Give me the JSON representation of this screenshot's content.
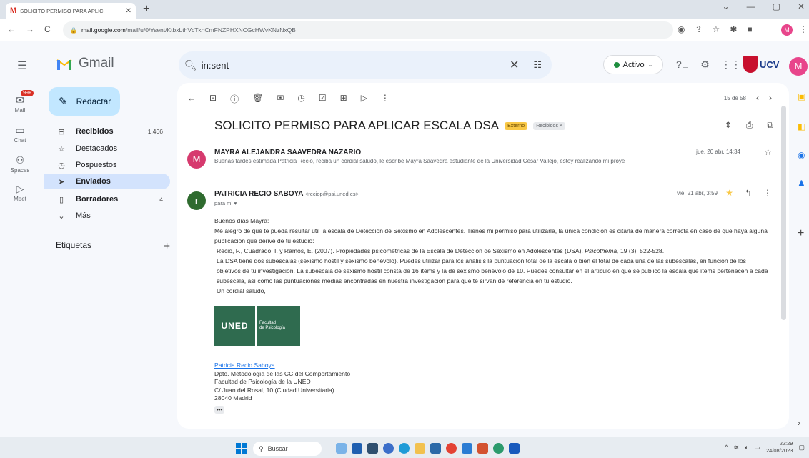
{
  "browser": {
    "tab_title": "SOLICITO PERMISO PARA APLIC.",
    "url_prefix": "mail.google.com",
    "url_rest": "/mail/u/0/#sent/KtbxLthVcTkhCmFNZPHXNCGcHWvKNzNxQB",
    "profile_initial": "M"
  },
  "gmail": {
    "logo_text": "Gmail",
    "search_value": "in:sent",
    "status_label": "Activo",
    "brand_logo_text": "UCV",
    "avatar_initial": "M"
  },
  "rail": [
    {
      "label": "Mail",
      "icon": "mail-icon",
      "badge": "99+"
    },
    {
      "label": "Chat",
      "icon": "chat-icon"
    },
    {
      "label": "Spaces",
      "icon": "spaces-icon"
    },
    {
      "label": "Meet",
      "icon": "meet-icon"
    }
  ],
  "compose_label": "Redactar",
  "nav": [
    {
      "label": "Recibidos",
      "count": "1.406",
      "icon": "inbox-icon",
      "bold": true
    },
    {
      "label": "Destacados",
      "count": "",
      "icon": "star-icon"
    },
    {
      "label": "Pospuestos",
      "count": "",
      "icon": "clock-icon"
    },
    {
      "label": "Enviados",
      "count": "",
      "icon": "send-icon",
      "bold": true,
      "active": true
    },
    {
      "label": "Borradores",
      "count": "4",
      "icon": "draft-icon",
      "bold": true
    },
    {
      "label": "Más",
      "count": "",
      "icon": "chevron-down-icon"
    }
  ],
  "labels_title": "Etiquetas",
  "thread": {
    "pager": "15 de 58",
    "subject": "SOLICITO PERMISO PARA APLICAR ESCALA DSA",
    "tag_external": "Externo",
    "tag_inbox": "Recibidos ×",
    "messages": [
      {
        "sender": "MAYRA ALEJANDRA SAAVEDRA NAZARIO",
        "avatar": "M",
        "date": "jue, 20 abr, 14:34",
        "snippet": "Buenas tardes estimada Patricia Recio, reciba un cordial saludo, le escribe Mayra Saavedra estudiante de la Universidad César Vallejo, estoy realizando mi proye"
      },
      {
        "sender": "PATRICIA RECIO SABOYA",
        "email": "<reciop@psi.uned.es>",
        "avatar": "r",
        "to": "para mí",
        "date": "vie, 21 abr, 3:59",
        "body": {
          "greeting": "Buenos días Mayra:",
          "p1": "Me alegro de que te pueda resultar útil la escala de Detección de Sexismo en Adolescentes. Tienes mi permiso para utilizarla, la única condición es citarla de manera correcta en caso de que haya alguna publicación que derive de tu estudio:",
          "ref_a": "Recio, P., Cuadrado, I. y Ramos, E. (2007). Propiedades psicométricas de la Escala de Detección de Sexismo en Adolescentes (DSA).",
          "ref_journal": "Psicothema,",
          "ref_b": "19 (3), 522-528.",
          "p2": "La DSA tiene dos subescalas (sexismo hostil y sexismo benévolo). Puedes utilizar para los análisis la puntuación total de la escala o bien el total de cada una de las subescalas, en función de los objetivos de tu investigación. La subescala de sexismo hostil consta de 16 ítems y la de sexismo benévolo de 10. Puedes consultar en el artículo en que se publicó la escala qué ítems pertenecen a cada subescala, así como las puntuaciones medias encontradas en nuestra investigación para que te sirvan de referencia en tu estudio.",
          "closing": "Un cordial saludo,"
        },
        "logo": {
          "main": "UNED",
          "sub1": "Facultad",
          "sub2": "de Psicología"
        },
        "signature": {
          "name": "Patricia Recio Saboya",
          "line1": "Dpto. Metodología de las CC del Comportamiento",
          "line2": "Facultad de Psicología de la UNED",
          "line3": "C/ Juan del Rosal, 10 (Ciudad Universitaria)",
          "line4": "28040 Madrid",
          "more": "•••"
        }
      }
    ]
  },
  "taskbar": {
    "search_placeholder": "Buscar",
    "time": "22:29",
    "date": "24/08/2023"
  },
  "colors": {
    "compose_bg": "#c2e7ff",
    "active_nav": "#d3e3fd",
    "search_bg": "#eaf1fb",
    "gmail_red": "#d93025",
    "uned_green": "#2f6b4f"
  }
}
